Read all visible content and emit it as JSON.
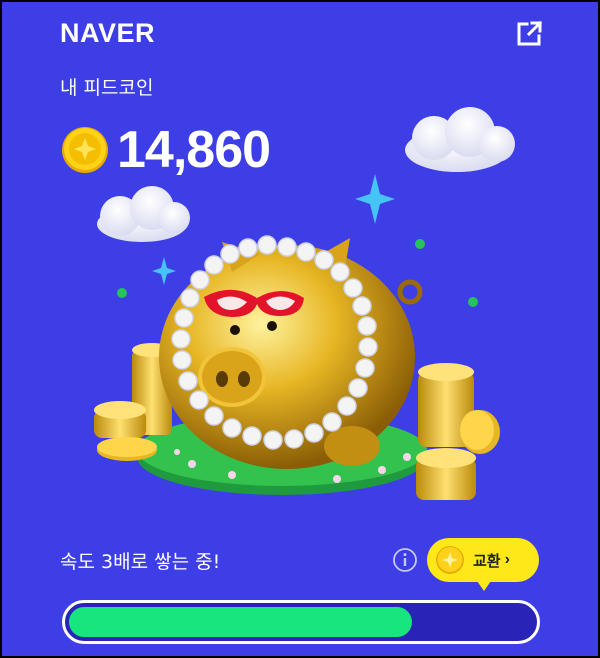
{
  "header": {
    "logo_text": "NAVER",
    "share_icon": "share-external-icon"
  },
  "wallet": {
    "title": "내 피드코인",
    "coin_icon": "coin-icon",
    "amount": "14,860"
  },
  "footer": {
    "status_text": "속도 3배로 쌓는 중!",
    "info_icon": "info-icon",
    "exchange_label": "교환",
    "exchange_chevron": "›"
  },
  "progress": {
    "fill_fraction": 0.74
  },
  "colors": {
    "background": "#3d3ee6",
    "coin": "#ffd21a",
    "button": "#ffe81a",
    "progress_fill": "#19e57f",
    "progress_track": "#2a23b8"
  }
}
